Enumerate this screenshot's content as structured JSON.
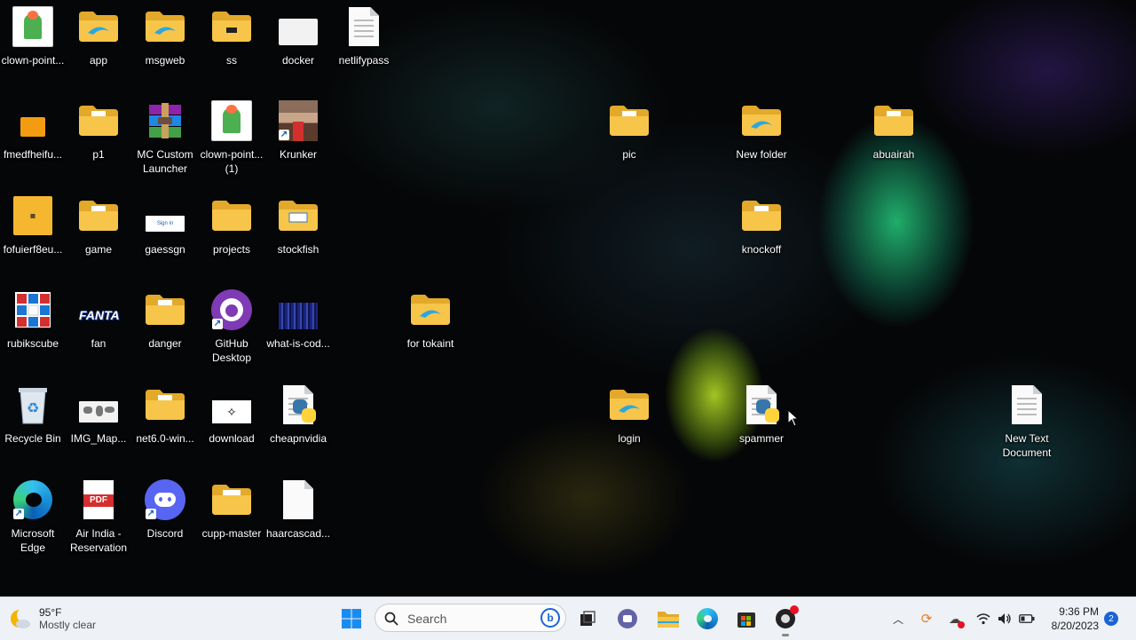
{
  "desktop": {
    "icons": {
      "clown_pointer": "clown-point...",
      "app": "app",
      "msgweb": "msgweb",
      "ss": "ss",
      "docker": "docker",
      "netlifypass": "netlifypass",
      "fmedfheifu": "fmedfheifu...",
      "p1": "p1",
      "mc_custom_launcher": "MC Custom Launcher",
      "clown_pointer_1": "clown-point... (1)",
      "krunker": "Krunker",
      "pic": "pic",
      "new_folder": "New folder",
      "abuairah": "abuairah",
      "fofuierf8eu": "fofuierf8eu...",
      "game": "game",
      "gaessgn": "gaessgn",
      "projects": "projects",
      "stockfish": "stockfish",
      "knockoff": "knockoff",
      "rubikscube": "rubikscube",
      "fan": "fan",
      "danger": "danger",
      "github_desktop": "GitHub Desktop",
      "what_is_code": "what-is-cod...",
      "for_tokaint": "for tokaint",
      "recycle_bin": "Recycle Bin",
      "img_map": "IMG_Map...",
      "net6": "net6.0-win...",
      "download": "download",
      "cheapnvidia": "cheapnvidia",
      "login": "login",
      "spammer": "spammer",
      "new_text_document": "New Text Document",
      "microsoft_edge": "Microsoft Edge",
      "air_india": "Air India - Reservation",
      "discord": "Discord",
      "cupp_master": "cupp-master",
      "haarcascade": "haarcascad..."
    },
    "fan_logo_text": "FANTA",
    "pdf_text": "PDF",
    "signin_text": "Sign in"
  },
  "taskbar": {
    "weather": {
      "temp": "95°F",
      "desc": "Mostly clear"
    },
    "search": {
      "placeholder": "Search"
    },
    "clock": {
      "time": "9:36 PM",
      "date": "8/20/2023"
    },
    "notifications": "2"
  },
  "colors": {
    "folder": "#f6c54a",
    "folder_dark": "#e3a92a",
    "taskbar_bg": "#eef1f6",
    "accent": "#1b64d4"
  }
}
